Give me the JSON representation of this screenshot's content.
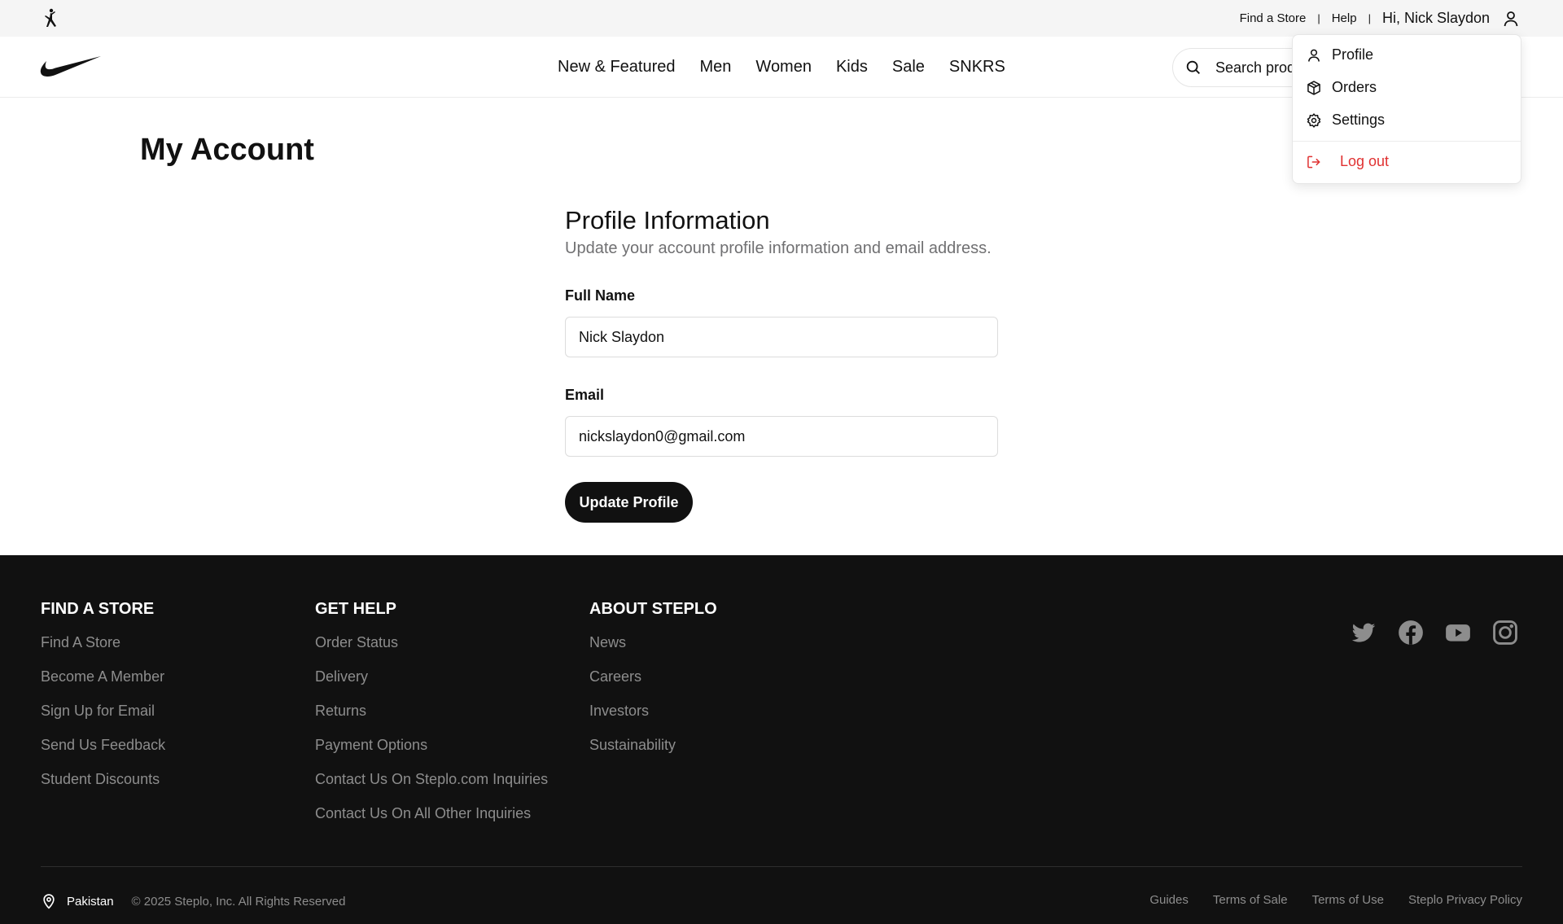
{
  "utility_bar": {
    "find_store": "Find a Store",
    "separator": "|",
    "help": "Help",
    "greeting": "Hi, Nick Slaydon",
    "user_icon": "user-icon"
  },
  "nav": {
    "logo_icon": "swoosh-logo",
    "items": [
      "New & Featured",
      "Men",
      "Women",
      "Kids",
      "Sale",
      "SNKRS"
    ],
    "search_placeholder": "Search products",
    "search_icon": "search-icon"
  },
  "account_menu": {
    "items": [
      {
        "label": "Profile",
        "icon": "user-icon"
      },
      {
        "label": "Orders",
        "icon": "package-icon"
      },
      {
        "label": "Settings",
        "icon": "gear-icon"
      }
    ],
    "logout": {
      "label": "Log out",
      "icon": "logout-icon",
      "color": "#e03131"
    }
  },
  "page": {
    "title": "My Account",
    "section_title": "Profile Information",
    "section_subtitle": "Update your account profile information and email address.",
    "full_name_label": "Full Name",
    "full_name_value": "Nick Slaydon",
    "email_label": "Email",
    "email_value": "nickslaydon0@gmail.com",
    "submit_label": "Update Profile"
  },
  "footer": {
    "columns": [
      {
        "title": "FIND A STORE",
        "links": [
          "Find A Store",
          "Become A Member",
          "Sign Up for Email",
          "Send Us Feedback",
          "Student Discounts"
        ]
      },
      {
        "title": "GET HELP",
        "links": [
          "Order Status",
          "Delivery",
          "Returns",
          "Payment Options",
          "Contact Us On Steplo.com Inquiries",
          "Contact Us On All Other Inquiries"
        ]
      },
      {
        "title": "ABOUT STEPLO",
        "links": [
          "News",
          "Careers",
          "Investors",
          "Sustainability"
        ]
      }
    ],
    "social_icons": [
      "twitter-icon",
      "facebook-icon",
      "youtube-icon",
      "instagram-icon"
    ],
    "country": "Pakistan",
    "copyright": "© 2025 Steplo, Inc. All Rights Reserved",
    "legal_links": [
      "Guides",
      "Terms of Sale",
      "Terms of Use",
      "Steplo Privacy Policy"
    ]
  },
  "colors": {
    "accent": "#111111",
    "footer_bg": "#111111",
    "muted_text": "#8d8d8d",
    "danger": "#e03131"
  }
}
